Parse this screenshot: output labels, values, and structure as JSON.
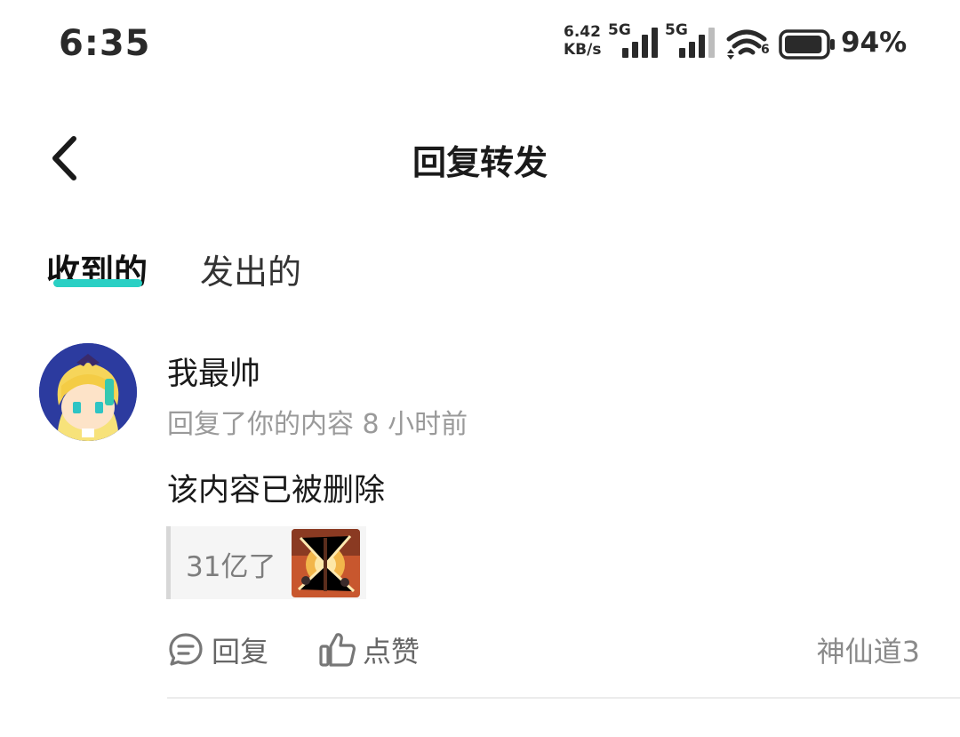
{
  "status_bar": {
    "time": "6:35",
    "net_speed_value": "6.42",
    "net_speed_unit": "KB/s",
    "sim1_label": "5G",
    "sim2_label": "5G",
    "wifi_label": "6",
    "battery_percent": "94%",
    "battery_level": 0.94
  },
  "header": {
    "title": "回复转发",
    "back_icon": "chevron-left-icon"
  },
  "tabs": [
    {
      "label": "收到的",
      "active": true
    },
    {
      "label": "发出的",
      "active": false
    }
  ],
  "accent_color": "#2ad0c4",
  "message": {
    "username": "我最帅",
    "meta": "回复了你的内容 8 小时前",
    "content": "该内容已被删除",
    "quote_text": "31亿了",
    "reply_label": "回复",
    "like_label": "点赞",
    "source": "神仙道3"
  }
}
